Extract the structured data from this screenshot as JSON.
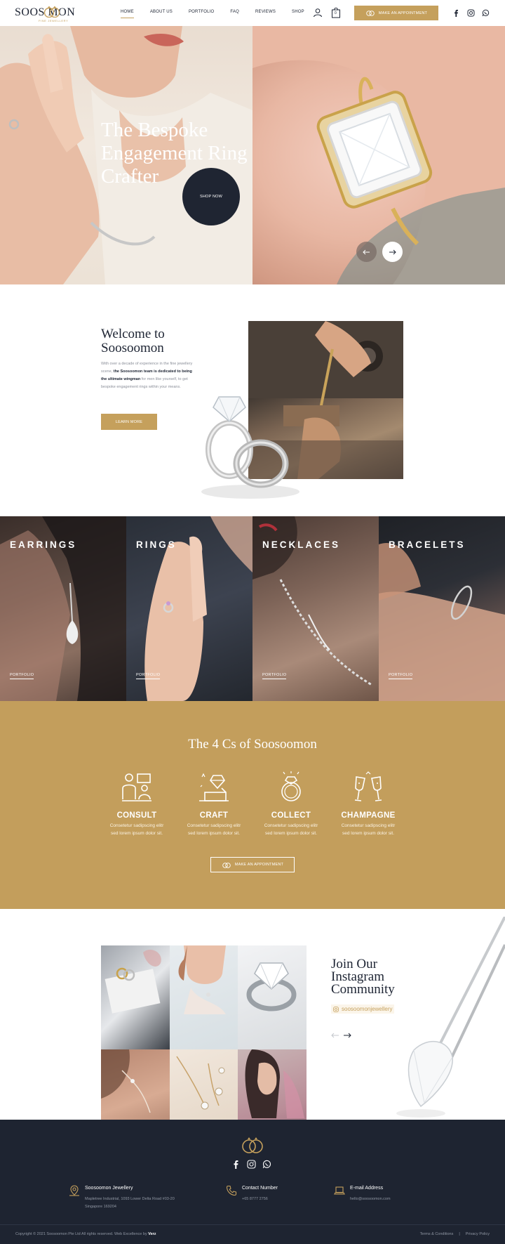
{
  "header": {
    "logo_text": "SOOS  MON",
    "logo_tagline": "FINE JEWELLERY",
    "nav": [
      "HOME",
      "ABOUT US",
      "PORTFOLIO",
      "FAQ",
      "REVIEWS",
      "SHOP"
    ],
    "cart_count": "0",
    "appointment_label": "MAKE AN APPOINTMENT",
    "accent_color": "#c5a05c"
  },
  "hero": {
    "title": "The Bespoke Engagement Ring Crafter",
    "shop_label": "SHOP NOW"
  },
  "welcome": {
    "title": "Welcome to Soosoomon",
    "body_pre": "With over a decade of experience in the fine jewellery scene, ",
    "body_bold": "the Soosoomon team is dedicated to being the ultimate wingman",
    "body_post": " for men like yourself, to get bespoke engagement rings within your means.",
    "button": "LEARN MORE"
  },
  "categories": [
    {
      "title": "EARRINGS",
      "link": "PORTFOLIO"
    },
    {
      "title": "RINGS",
      "link": "PORTFOLIO"
    },
    {
      "title": "NECKLACES",
      "link": "PORTFOLIO"
    },
    {
      "title": "BRACELETS",
      "link": "PORTFOLIO"
    }
  ],
  "four_cs": {
    "title": "The 4 Cs of Soosoomon",
    "items": [
      {
        "name": "CONSULT",
        "desc1": "Consetetur sadipscing elitr",
        "desc2": "sed lorem ipsum dolor sit.",
        "icon": "consult-icon"
      },
      {
        "name": "CRAFT",
        "desc1": "Consetetur sadipscing elitr",
        "desc2": "sed lorem ipsum dolor sit.",
        "icon": "craft-icon"
      },
      {
        "name": "COLLECT",
        "desc1": "Consetetur sadipscing elitr",
        "desc2": "sed lorem ipsum dolor sit.",
        "icon": "collect-icon"
      },
      {
        "name": "CHAMPAGNE",
        "desc1": "Consetetur sadipscing elitr",
        "desc2": "sed lorem ipsum dolor sit.",
        "icon": "champagne-icon"
      }
    ],
    "button": "MAKE AN APPOINTMENT",
    "bg_color": "#c39e5c"
  },
  "instagram": {
    "title": "Join Our Instagram Community",
    "handle": "soosoomonjewellery"
  },
  "footer": {
    "company": {
      "head": "Soosoomon Jewellery",
      "line1": "Mapletree Industrial, 1093 Lower Delta Road #03-20",
      "line2": "Singapore 169204"
    },
    "contact": {
      "head": "Contact Number",
      "line1": "+65 8777 2756"
    },
    "email": {
      "head": "E-mail Address",
      "line1": "hello@soosoomon.com"
    },
    "copyright": "Copyright © 2021 Soosoomon Pte Ltd All rights reserved. Web Excellence by ",
    "credit": "Verz",
    "terms": "Terms & Conditions",
    "separator": "|",
    "privacy": "Privacy Policy",
    "bg_color": "#1e2431"
  }
}
